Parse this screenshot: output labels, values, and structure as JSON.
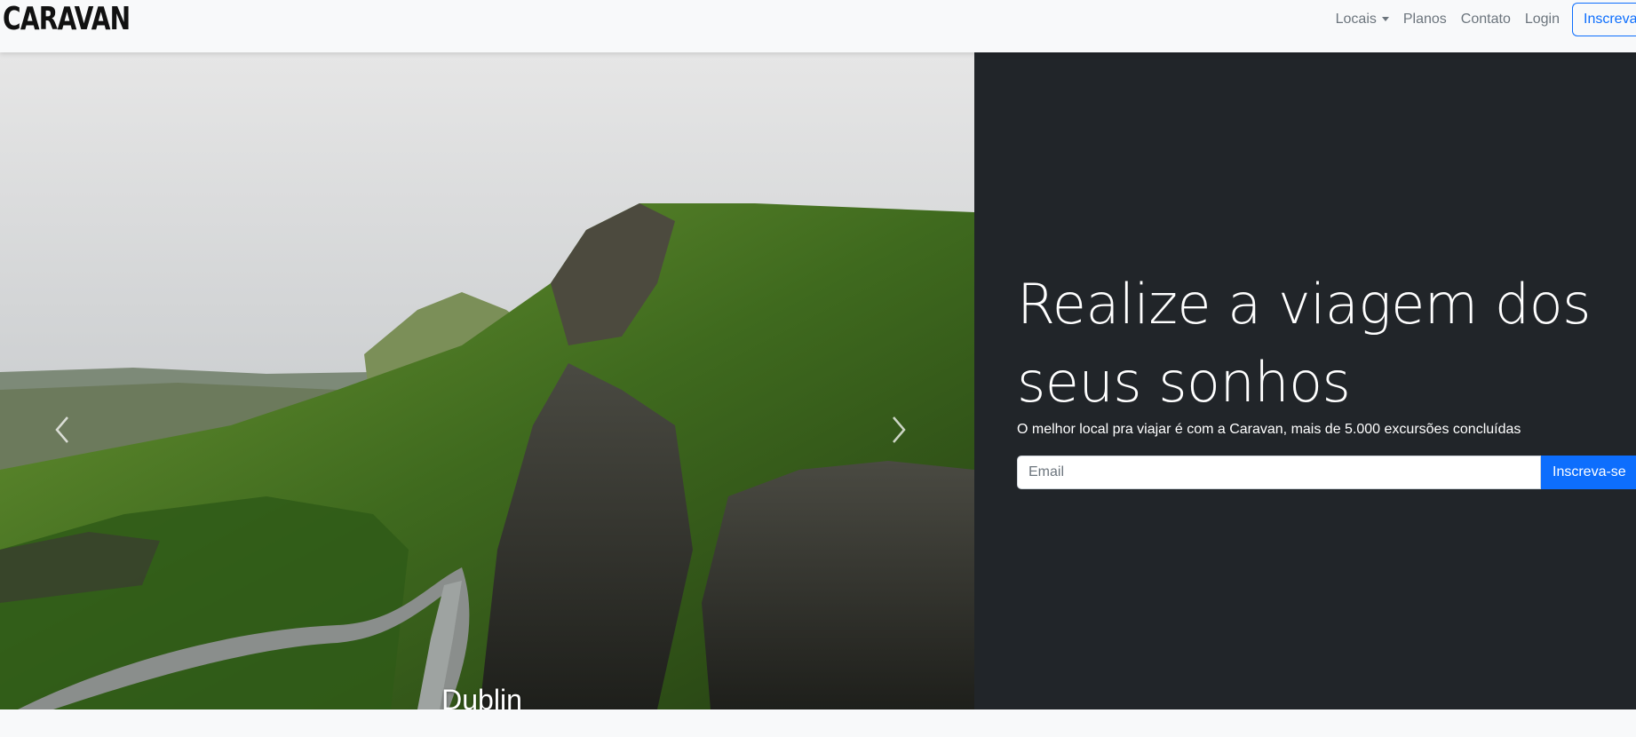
{
  "brand": "CARAVAN",
  "nav": {
    "items": [
      {
        "label": "Locais"
      },
      {
        "label": "Planos"
      },
      {
        "label": "Contato"
      },
      {
        "label": "Login"
      }
    ],
    "cta": "Inscreva-se"
  },
  "carousel": {
    "caption": "Dublin",
    "slides_count": 3,
    "active_slide": 1
  },
  "hero": {
    "headline": "Realize a viagem dos seus sonhos",
    "subtitle": "O melhor local pra viajar é com a Caravan, mais de 5.000 excursões concluídas",
    "email_placeholder": "Email",
    "submit_label": "Inscreva-se"
  },
  "colors": {
    "primary": "#0d6efd",
    "dark": "#212529",
    "light": "#f8f9fa"
  }
}
